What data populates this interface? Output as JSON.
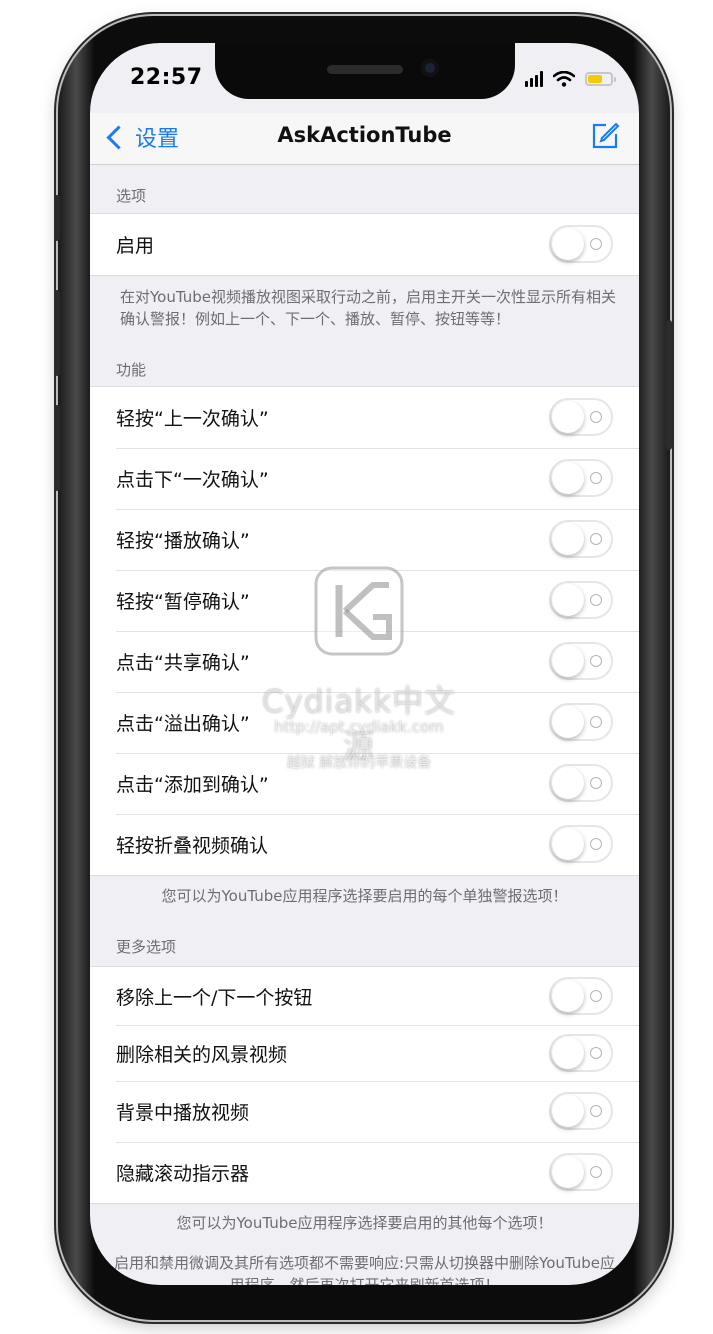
{
  "status_bar": {
    "time": "22:57"
  },
  "navbar": {
    "back_label": "设置",
    "title": "AskActionTube"
  },
  "sections": [
    {
      "header": "选项",
      "rows": [
        {
          "label": "启用",
          "on": false
        }
      ],
      "footer": "在对YouTube视频播放视图采取行动之前，启用主开关一次性显示所有相关确认警报！例如上一个、下一个、播放、暂停、按钮等等！"
    },
    {
      "header": "功能",
      "rows": [
        {
          "label": "轻按“上一次确认”",
          "on": false
        },
        {
          "label": "点击下“一次确认”",
          "on": false
        },
        {
          "label": "轻按“播放确认”",
          "on": false
        },
        {
          "label": "轻按“暂停确认”",
          "on": false
        },
        {
          "label": "点击“共享确认”",
          "on": false
        },
        {
          "label": "点击“溢出确认”",
          "on": false
        },
        {
          "label": "点击“添加到确认”",
          "on": false
        },
        {
          "label": "轻按折叠视频确认",
          "on": false
        }
      ],
      "footer": "您可以为YouTube应用程序选择要启用的每个单独警报选项！"
    },
    {
      "header": "更多选项",
      "rows": [
        {
          "label": "移除上一个/下一个按钮",
          "on": false
        },
        {
          "label": "删除相关的风景视频",
          "on": false
        },
        {
          "label": "背景中播放视频",
          "on": false
        },
        {
          "label": "隐藏滚动指示器",
          "on": false
        }
      ],
      "footer": "您可以为YouTube应用程序选择要启用的其他每个选项！",
      "footer2": "启用和禁用微调及其所有选项都不需要响应:只需从切换器中删除YouTube应用程序，然后再次打开它来刷新首选项！"
    }
  ],
  "watermark": {
    "name": "Cydiakk中文源",
    "url": "http://apt.cydiakk.com",
    "slogan": "越狱 解放你的苹果设备"
  },
  "colors": {
    "accent": "#1a7cf5",
    "background": "#efeff4",
    "toggle_off": "#ffffff"
  }
}
